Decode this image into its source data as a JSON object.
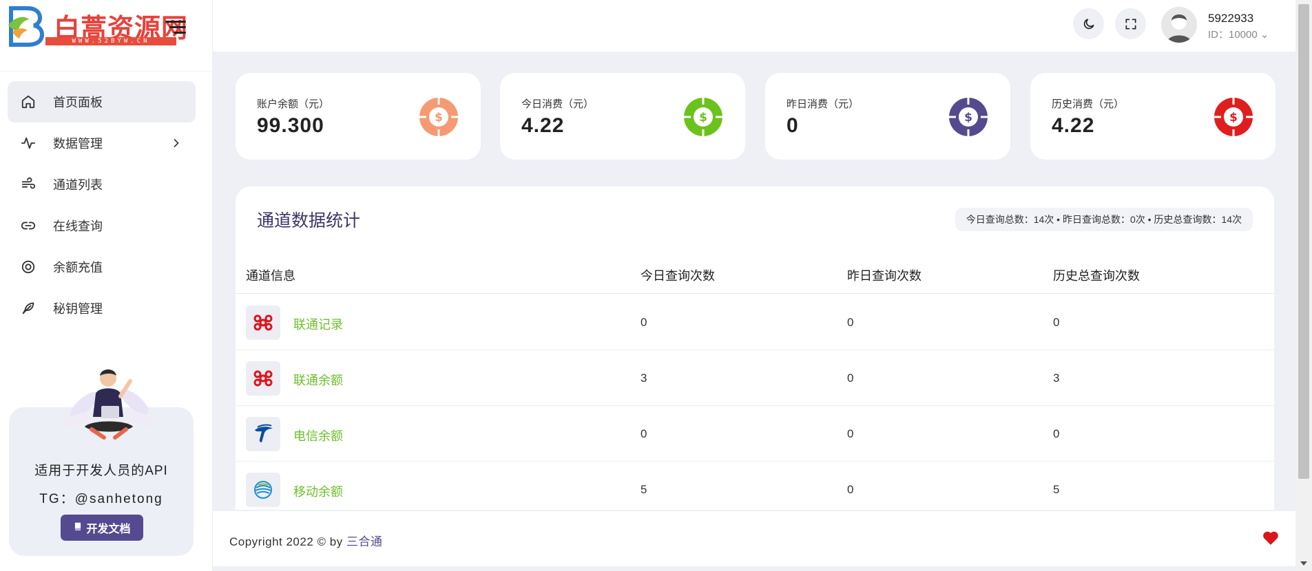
{
  "brand": {
    "logo_text": "白蒿资源网",
    "logo_sub": "WWW.52BYW.CN"
  },
  "sidebar": {
    "items": [
      {
        "label": "首页面板",
        "icon": "home-icon"
      },
      {
        "label": "数据管理",
        "icon": "activity-icon"
      },
      {
        "label": "通道列表",
        "icon": "wind-icon"
      },
      {
        "label": "在线查询",
        "icon": "link-icon"
      },
      {
        "label": "余额充值",
        "icon": "target-icon"
      },
      {
        "label": "秘钥管理",
        "icon": "feather-icon"
      }
    ],
    "promo": {
      "line1": "适用于开发人员的API",
      "line2": "TG：@sanhetong",
      "button": "开发文档"
    }
  },
  "header": {
    "username": "5922933",
    "user_id": "ID：10000"
  },
  "cards": [
    {
      "label": "账户余额（元）",
      "value": "99.300",
      "color": "#f59a73"
    },
    {
      "label": "今日消费（元）",
      "value": "4.22",
      "color": "#6cc21c"
    },
    {
      "label": "昨日消费（元）",
      "value": "0",
      "color": "#554a8f"
    },
    {
      "label": "历史消费（元）",
      "value": "4.22",
      "color": "#df1f1f"
    }
  ],
  "stats": {
    "title": "通道数据统计",
    "summary": "今日查询总数：14次 • 昨日查询总数：0次 • 历史总查询数：14次",
    "columns": [
      "通道信息",
      "今日查询次数",
      "昨日查询次数",
      "历史总查询次数"
    ],
    "rows": [
      {
        "name": "联通记录",
        "logo": "china-unicom-logo",
        "today": "0",
        "yesterday": "0",
        "total": "0"
      },
      {
        "name": "联通余额",
        "logo": "china-unicom-logo",
        "today": "3",
        "yesterday": "0",
        "total": "3"
      },
      {
        "name": "电信余额",
        "logo": "china-telecom-logo",
        "today": "0",
        "yesterday": "0",
        "total": "0"
      },
      {
        "name": "移动余额",
        "logo": "china-mobile-logo",
        "today": "5",
        "yesterday": "0",
        "total": "5"
      }
    ]
  },
  "footer": {
    "copyright": "Copyright 2022 © by ",
    "owner": "三合通"
  }
}
